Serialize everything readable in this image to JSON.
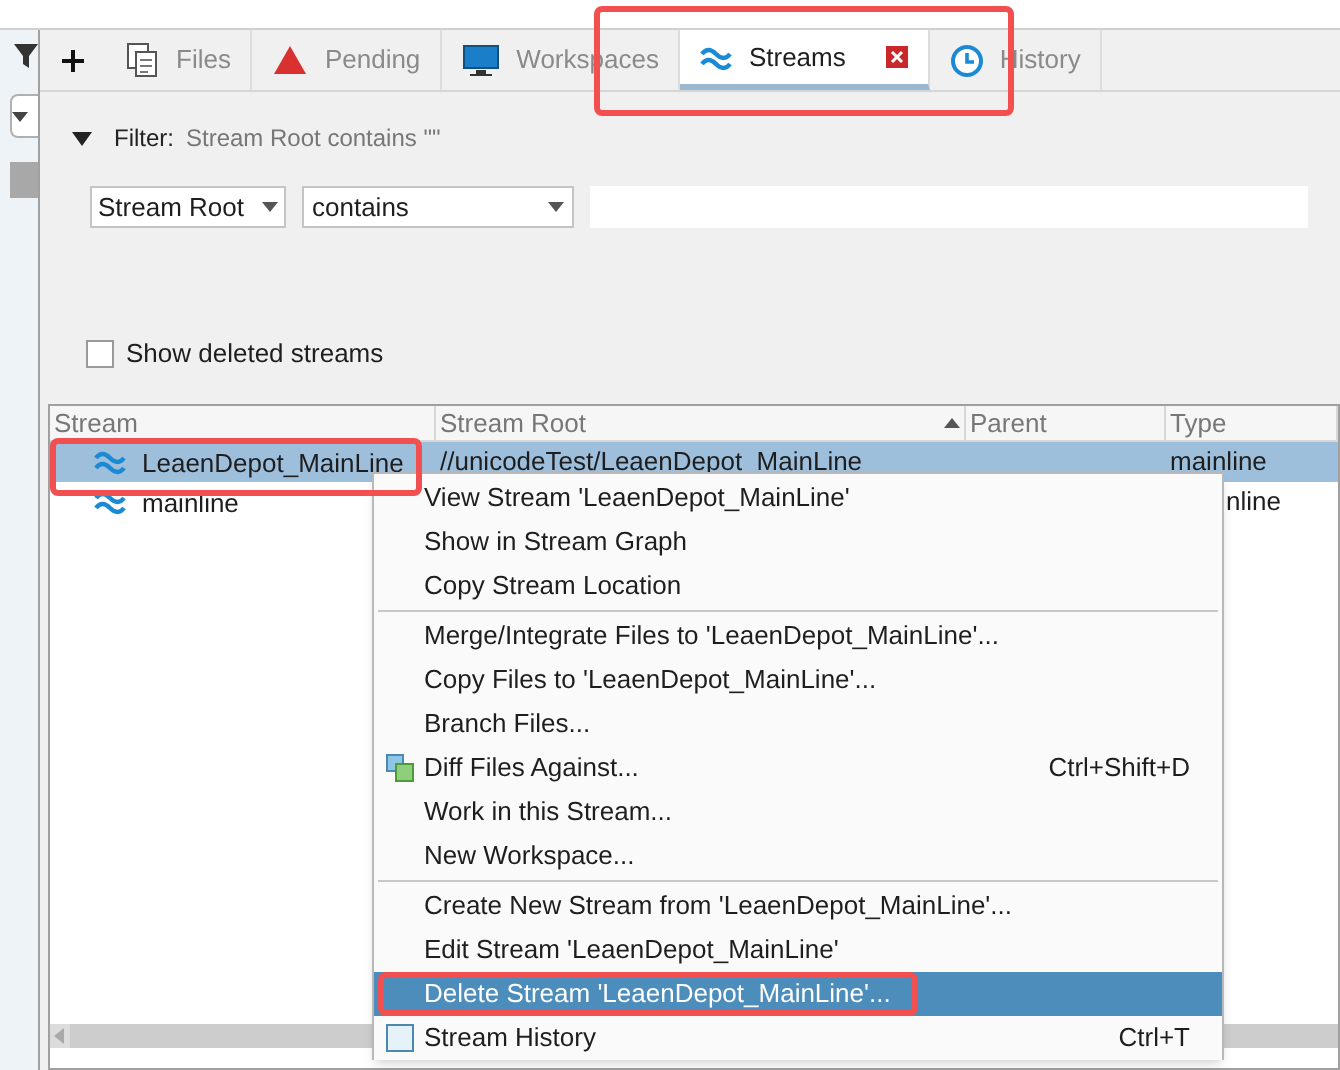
{
  "tabs": [
    {
      "kind": "files",
      "label": "Files",
      "selected": false
    },
    {
      "kind": "pending",
      "label": "Pending",
      "selected": false
    },
    {
      "kind": "workspaces",
      "label": "Workspaces",
      "selected": false
    },
    {
      "kind": "streams",
      "label": "Streams",
      "selected": true
    },
    {
      "kind": "history",
      "label": "History",
      "selected": false
    }
  ],
  "filter": {
    "expanded": true,
    "label": "Filter:",
    "summary": "Stream Root contains \"\"",
    "field": "Stream Root",
    "operator": "contains"
  },
  "show_deleted": {
    "label": "Show deleted streams",
    "checked": false
  },
  "table": {
    "columns": [
      "Stream",
      "Stream Root",
      "Parent",
      "Type"
    ],
    "rows": [
      {
        "stream": "LeaenDepot_MainLine",
        "stream_root": "//unicodeTest/LeaenDepot_MainLine",
        "parent": "",
        "type": "mainline",
        "selected": true
      },
      {
        "stream": "mainline",
        "stream_root": "",
        "parent": "",
        "type": "nline",
        "selected": false
      }
    ]
  },
  "context_menu": {
    "items": [
      {
        "label": "View Stream 'LeaenDepot_MainLine'",
        "highlighted": false,
        "separator_before": false
      },
      {
        "label": "Show in Stream Graph",
        "highlighted": false,
        "separator_before": false
      },
      {
        "label": "Copy Stream Location",
        "highlighted": false,
        "separator_before": false
      },
      {
        "label": "Merge/Integrate Files to 'LeaenDepot_MainLine'...",
        "highlighted": false,
        "separator_before": true
      },
      {
        "label": "Copy Files to 'LeaenDepot_MainLine'...",
        "highlighted": false,
        "separator_before": false
      },
      {
        "label": "Branch Files...",
        "highlighted": false,
        "separator_before": false
      },
      {
        "label": "Diff Files Against...",
        "shortcut": "Ctrl+Shift+D",
        "kind": "diff",
        "highlighted": false,
        "separator_before": false
      },
      {
        "label": "Work in this Stream...",
        "highlighted": false,
        "separator_before": false
      },
      {
        "label": "New Workspace...",
        "highlighted": false,
        "separator_before": false
      },
      {
        "label": "Create New Stream from 'LeaenDepot_MainLine'...",
        "highlighted": false,
        "separator_before": true
      },
      {
        "label": "Edit Stream 'LeaenDepot_MainLine'",
        "highlighted": false,
        "separator_before": false
      },
      {
        "label": "Delete Stream 'LeaenDepot_MainLine'...",
        "highlighted": true,
        "separator_before": false
      },
      {
        "label": "Stream History",
        "shortcut": "Ctrl+T",
        "kind": "history",
        "highlighted": false,
        "separator_before": false
      }
    ]
  }
}
